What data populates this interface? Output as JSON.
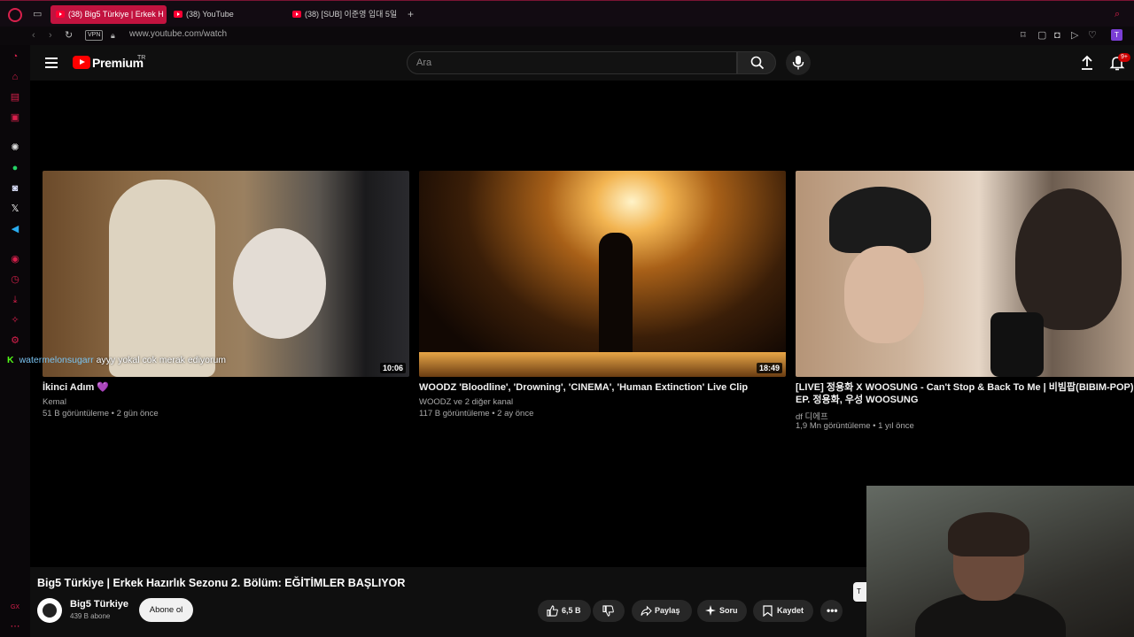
{
  "browser": {
    "tabs": [
      {
        "label": "(38) Big5 Türkiye | Erkek H",
        "active": true
      },
      {
        "label": "(38) YouTube",
        "active": false
      },
      {
        "label": "(38) [SUB] 이준영 입대 5일",
        "active": false
      }
    ],
    "new_tab_label": "+",
    "vpn_label": "VPN",
    "url": "www.youtube.com/watch"
  },
  "youtube": {
    "logo_text": "Premium",
    "region": "TR",
    "search_placeholder": "Ara",
    "notification_count": "9+"
  },
  "videos": [
    {
      "title": "İkinci Adım 💜",
      "channel": "Kemal",
      "meta": "51 B görüntüleme • 2 gün önce",
      "duration": "10:06"
    },
    {
      "title": "WOODZ 'Bloodline', 'Drowning', 'CINEMA', 'Human Extinction' Live Clip",
      "channel": "WOODZ ve 2 diğer kanal",
      "meta": "117 B görüntüleme • 2 ay önce",
      "duration": "18:49"
    },
    {
      "title": "[LIVE] 정용화 X WOOSUNG - Can't Stop & Back To Me | 비빔팝(BIBIM-POP) EP. 정용화, 우성 WOOSUNG",
      "channel": "df 디에프",
      "meta": "1,9 Mn görüntüleme • 1 yıl önce",
      "duration": ""
    }
  ],
  "chat": {
    "user": "watermelonsugarr",
    "message": "ayyy yokal cok merak ediyorum"
  },
  "player": {
    "title": "Big5 Türkiye | Erkek Hazırlık Sezonu 2. Bölüm: EĞİTİMLER BAŞLIYOR",
    "channel": "Big5 Türkiye",
    "subscribers": "439 B abone",
    "subscribe_label": "Abone ol",
    "likes": "6,5 B",
    "share_label": "Paylaş",
    "ask_label": "Soru",
    "save_label": "Kaydet"
  },
  "colors": {
    "opera_red": "#c2133f",
    "youtube_red": "#ff0000",
    "kick_green": "#53fc18"
  }
}
